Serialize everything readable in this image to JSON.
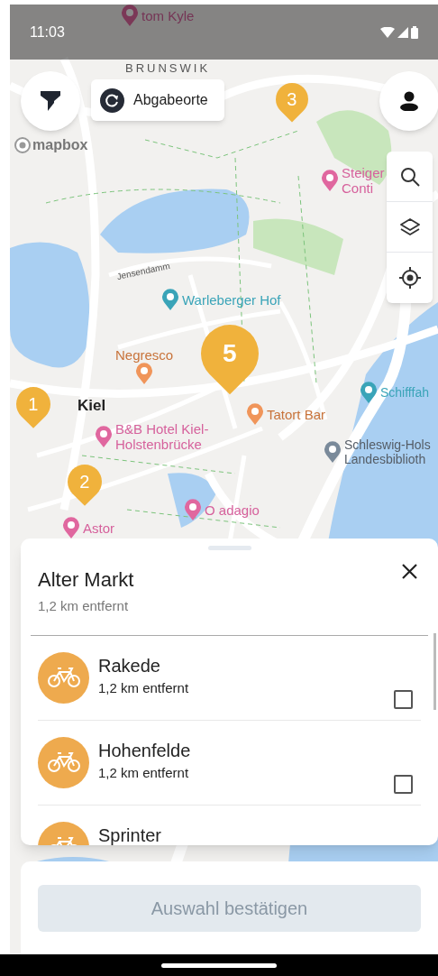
{
  "status_bar": {
    "time": "11:03"
  },
  "map": {
    "labels": [
      {
        "text": "tom Kyle",
        "kind": "hotel"
      },
      {
        "text": "BRUNSWIK",
        "kind": "district"
      },
      {
        "text": "Steiger\nConti",
        "kind": "hotel"
      },
      {
        "text": "Jensendamm",
        "kind": "street"
      },
      {
        "text": "Warleberger Hof",
        "kind": "museum"
      },
      {
        "text": "Negresco",
        "kind": "food"
      },
      {
        "text": "Kiel",
        "kind": "city"
      },
      {
        "text": "B&B Hotel Kiel-\nHolstenbrücke",
        "kind": "hotel"
      },
      {
        "text": "Tatort Bar",
        "kind": "food"
      },
      {
        "text": "Schifffah",
        "kind": "museum"
      },
      {
        "text": "Schleswig-Hols\nLandesbiblioth",
        "kind": "library"
      },
      {
        "text": "O adagio",
        "kind": "hotel"
      },
      {
        "text": "Astor",
        "kind": "hotel"
      }
    ],
    "clusters": [
      {
        "count": "3"
      },
      {
        "count": "5"
      },
      {
        "count": "1"
      },
      {
        "count": "2"
      }
    ],
    "attribution": "mapbox"
  },
  "filter_chip": {
    "label": "Abgabeorte"
  },
  "sheet": {
    "title": "Alter Markt",
    "subtitle": "1,2 km entfernt",
    "items": [
      {
        "name": "Rakede",
        "distance": "1,2 km entfernt",
        "checked": false
      },
      {
        "name": "Hohenfelde",
        "distance": "1,2 km entfernt",
        "checked": false
      },
      {
        "name": "Sprinter"
      }
    ]
  },
  "confirm_button": {
    "label": "Auswahl bestätigen",
    "disabled": true
  }
}
